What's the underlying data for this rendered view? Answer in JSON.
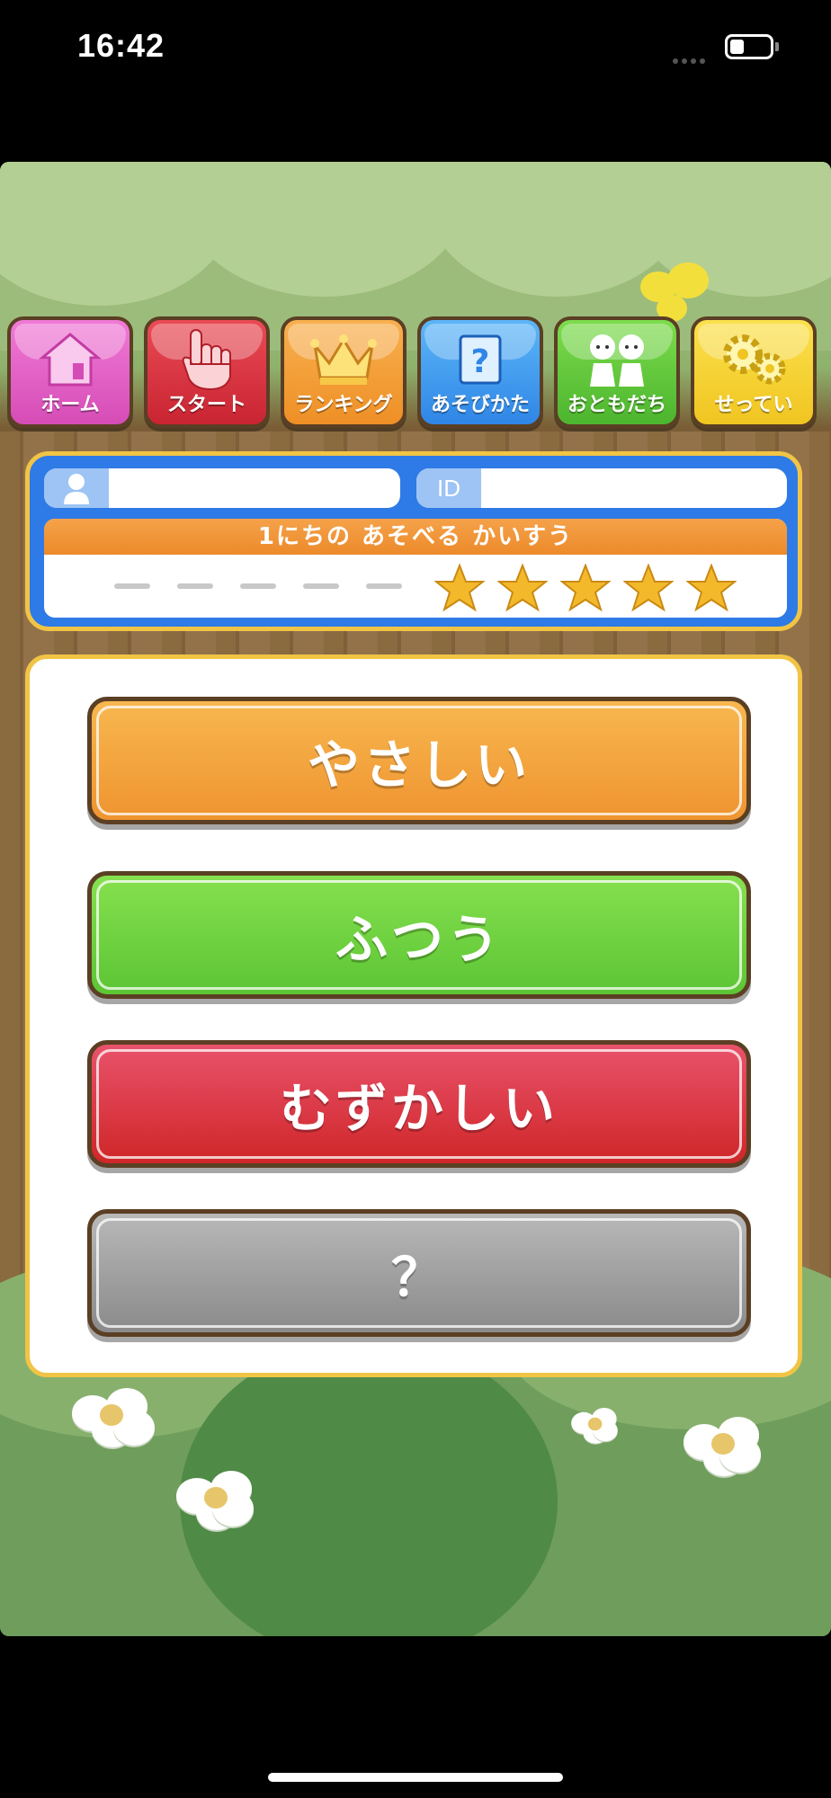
{
  "status_bar": {
    "time": "16:42",
    "battery_level": 0.35,
    "icons": [
      "cellular-dots-icon",
      "battery-icon"
    ]
  },
  "nav": {
    "items": [
      {
        "label": "ホーム",
        "icon": "home-icon",
        "color": "#e560c8"
      },
      {
        "label": "スタート",
        "icon": "pointing-hand-icon",
        "color": "#dd3743"
      },
      {
        "label": "ランキング",
        "icon": "crown-icon",
        "color": "#f4a03b"
      },
      {
        "label": "あそびかた",
        "icon": "question-icon",
        "color": "#469ef0"
      },
      {
        "label": "おともだち",
        "icon": "friends-icon",
        "color": "#65cb3d"
      },
      {
        "label": "せってい",
        "icon": "gears-icon",
        "color": "#f6d536"
      }
    ]
  },
  "profile": {
    "user_icon": "user-icon",
    "user_name": "",
    "id_label": "ID",
    "id_value": ""
  },
  "daily_plays": {
    "title": "1にちの あそべる かいすう",
    "max": 10,
    "remaining": 5,
    "star_color": "#f3b92b"
  },
  "difficulty": {
    "options": [
      {
        "label": "やさしい",
        "color": "#f4a53f"
      },
      {
        "label": "ふつう",
        "color": "#70d343"
      },
      {
        "label": "むずかしい",
        "color": "#dc3a45"
      },
      {
        "label": "？",
        "color": "#a0a0a0"
      }
    ]
  }
}
